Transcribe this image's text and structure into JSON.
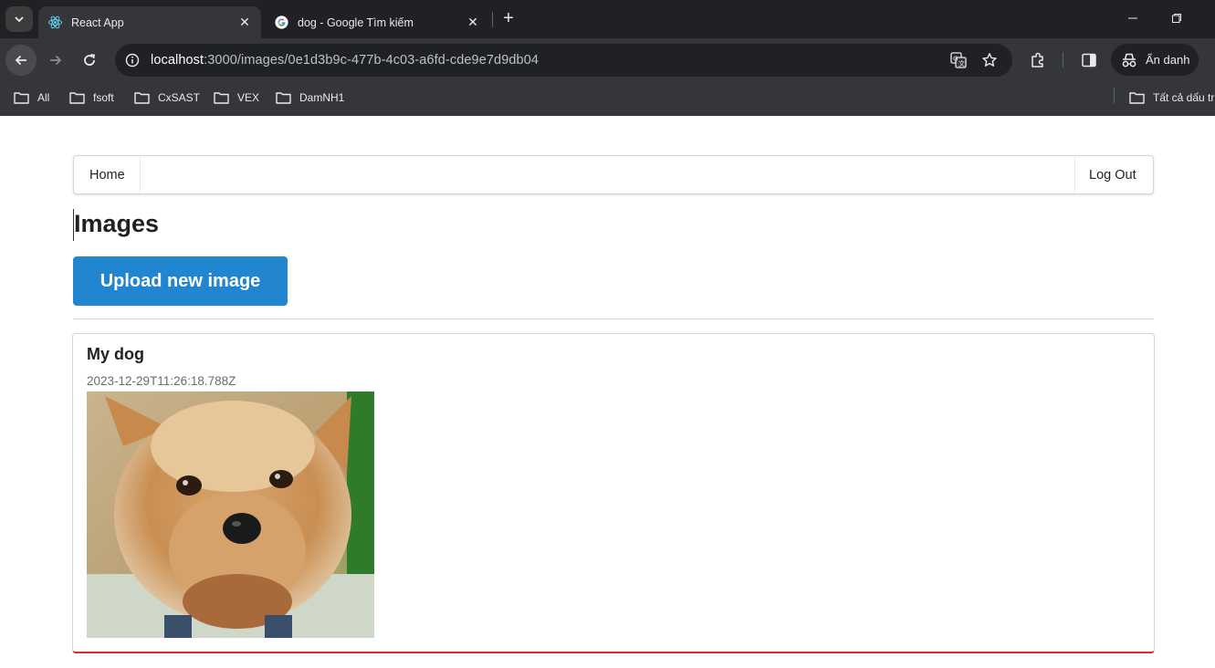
{
  "browser": {
    "tabs": [
      {
        "title": "React App",
        "active": true
      },
      {
        "title": "dog - Google Tìm kiếm",
        "active": false
      }
    ],
    "url": {
      "host": "localhost",
      "path": ":3000/images/0e1d3b9c-477b-4c03-a6fd-cde9e7d9db04"
    },
    "profile_label": "Ẩn danh",
    "bookmarks": [
      "All",
      "fsoft",
      "CxSAST",
      "VEX",
      "DamNH1"
    ],
    "bookmarks_overflow": "Tất cả dấu tra"
  },
  "app": {
    "nav": {
      "home": "Home",
      "logout": "Log Out"
    },
    "title": "Images",
    "upload_button": "Upload new image",
    "images": [
      {
        "name": "My dog",
        "created_at": "2023-12-29T11:26:18.788Z"
      }
    ]
  },
  "colors": {
    "primary_button": "#2185d0",
    "card_accent": "#db2828",
    "chrome_bg": "#35363a",
    "tabstrip_bg": "#202124"
  }
}
